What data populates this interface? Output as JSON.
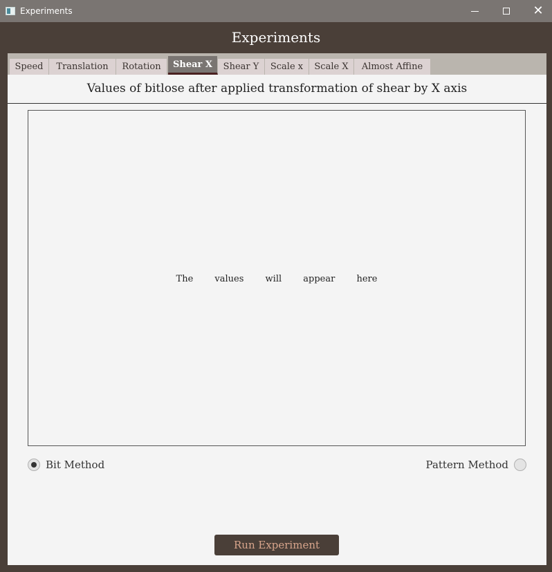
{
  "window": {
    "title": "Experiments",
    "controls": {
      "minimize": "minimize-icon",
      "maximize": "maximize-icon",
      "close": "close-icon"
    }
  },
  "header": {
    "title": "Experiments"
  },
  "tabs": [
    {
      "label": "Speed"
    },
    {
      "label": "Translation"
    },
    {
      "label": "Rotation"
    },
    {
      "label": "Shear X",
      "active": true
    },
    {
      "label": "Shear Y"
    },
    {
      "label": "Scale x"
    },
    {
      "label": "Scale X"
    },
    {
      "label": "Almost Affine"
    }
  ],
  "panel": {
    "heading": "Values of bitlose after applied transformation of shear by X axis",
    "placeholder": "The values will appear here"
  },
  "methods": {
    "bit": {
      "label": "Bit Method",
      "checked": true
    },
    "pattern": {
      "label": "Pattern Method",
      "checked": false
    }
  },
  "actions": {
    "run_label": "Run Experiment"
  },
  "colors": {
    "frame": "#4a3f38",
    "titlebar": "#7a7572",
    "tab_bg": "#dcd2d2",
    "tab_active": "#7a7572",
    "content_bg": "#f4f4f4",
    "run_text": "#d8a58c"
  }
}
